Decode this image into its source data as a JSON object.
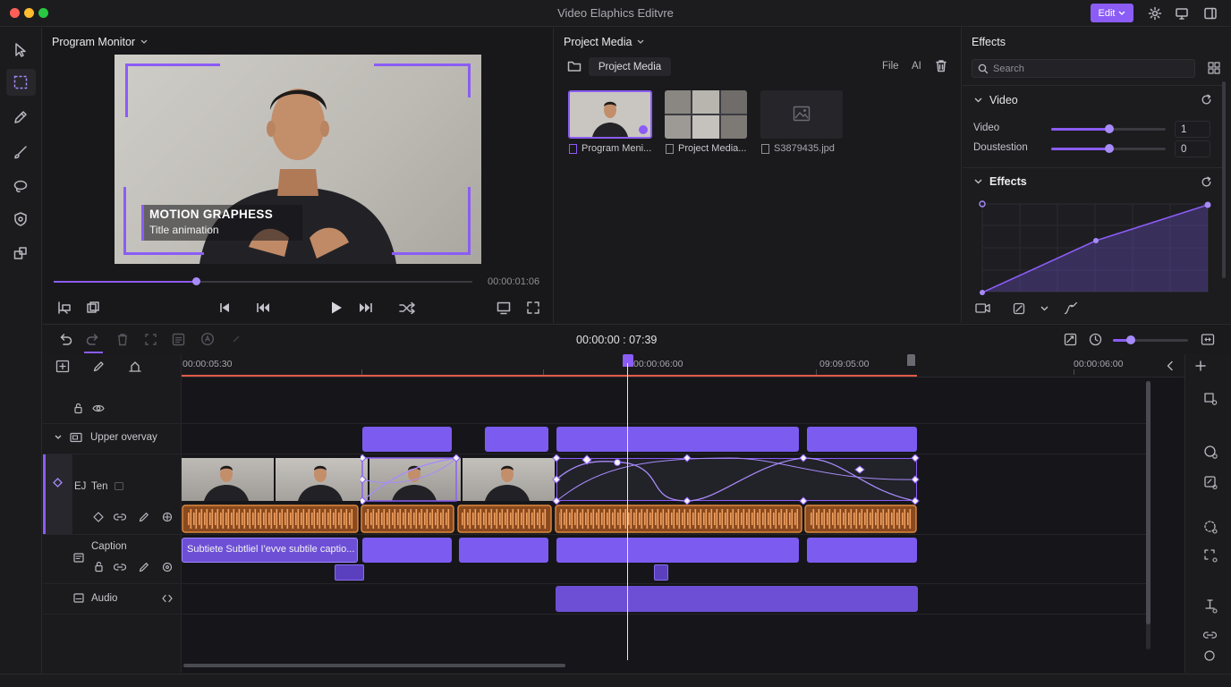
{
  "app": {
    "title": "Video Elaphics Editvre",
    "edit_label": "Edit"
  },
  "program_monitor": {
    "title": "Program Monitor",
    "overlay_title": "MOTION GRAPHESS",
    "overlay_subtitle": "Title animation",
    "timecode": "00:00:01:06",
    "progress": 0.34
  },
  "project_media": {
    "title": "Project Media",
    "folder_label": "Project Media",
    "file_label": "File",
    "ai_label": "AI",
    "items": [
      {
        "name": "Program Meni..."
      },
      {
        "name": "Project Media..."
      },
      {
        "name": "S3879435.jpd"
      }
    ]
  },
  "effects": {
    "title": "Effects",
    "search_placeholder": "Search",
    "video_section": "Video",
    "params": [
      {
        "label": "Video",
        "value": "1",
        "level": 0.5
      },
      {
        "label": "Doustestion",
        "value": "0",
        "level": 0.5
      }
    ],
    "effects_section": "Effects"
  },
  "timeline": {
    "timecode": "00:00:00 : 07:39",
    "ruler": [
      "00:00:05:30",
      "00:00:06:00",
      "09:09:05:00",
      "00:00:06:00"
    ],
    "tracks": {
      "upper_overlay": "Upper overvay",
      "video_track": "Ten",
      "video_prefix": "EJ",
      "caption": "Caption",
      "caption_clip": "Subtiete Subtliel I'evve subtile captio...",
      "audio": "Audio"
    }
  }
}
